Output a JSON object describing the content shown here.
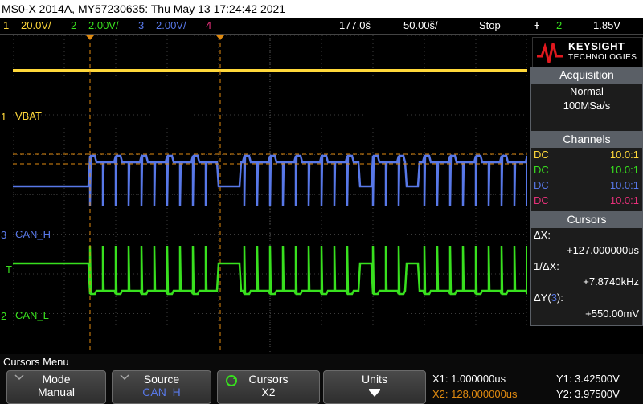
{
  "title": "MS0-X 2014A, MY57230635: Thu May 13 17:24:42 2021",
  "status": {
    "ch1": {
      "num": "1",
      "scale": "20.0V/"
    },
    "ch2": {
      "num": "2",
      "scale": "2.00V/"
    },
    "ch3": {
      "num": "3",
      "scale": "2.00V/"
    },
    "ch4": {
      "num": "4"
    },
    "delay": "177.0š",
    "timebase": "50.00š/",
    "run_state": "Stop",
    "trigger_icon": "Ŧ",
    "trigger_ch": "2",
    "trigger_level": "1.85V"
  },
  "colors": {
    "ch1": "#ffd83a",
    "ch2": "#38e01e",
    "ch3": "#5878e8",
    "ch4": "#e8307a",
    "cursor": "#e08a10",
    "panel_header": "#5a5f66"
  },
  "channel_labels": {
    "ch1_marker": "1",
    "ch1": "VBAT",
    "ch3_marker": "3",
    "ch3": "CAN_H",
    "ch2_marker": "2",
    "ch2": "CAN_L",
    "trigger_marker": "T"
  },
  "brand": {
    "name": "KEYSIGHT",
    "sub": "TECHNOLOGIES",
    "icon": "keysight-wave-icon"
  },
  "acquisition": {
    "header": "Acquisition",
    "mode": "Normal",
    "rate": "100MSa/s"
  },
  "channels": {
    "header": "Channels",
    "rows": [
      {
        "coupling": "DC",
        "probe": "10.0:1"
      },
      {
        "coupling": "DC",
        "probe": "10.0:1"
      },
      {
        "coupling": "DC",
        "probe": "10.0:1"
      },
      {
        "coupling": "DC",
        "probe": "10.0:1"
      }
    ]
  },
  "cursors": {
    "header": "Cursors",
    "dx_label": "ΔX:",
    "dx_value": "+127.000000us",
    "inv_label": "1/ΔX:",
    "inv_value": "+7.8740kHz",
    "dy_label_pre": "ΔY(",
    "dy_ch": "3",
    "dy_label_post": "):",
    "dy_value": "+550.00mV"
  },
  "menu": {
    "title": "Cursors Menu",
    "buttons": [
      {
        "label": "Mode",
        "value": "Manual"
      },
      {
        "label": "Source",
        "value": "CAN_H"
      },
      {
        "label": "Cursors",
        "value": "X2"
      },
      {
        "label": "Units",
        "value": ""
      }
    ]
  },
  "readouts": {
    "x1": "X1: 1.000000us",
    "x2": "X2: 128.000000us",
    "y1": "Y1: 3.42500V",
    "y2": "Y2: 3.97500V"
  }
}
